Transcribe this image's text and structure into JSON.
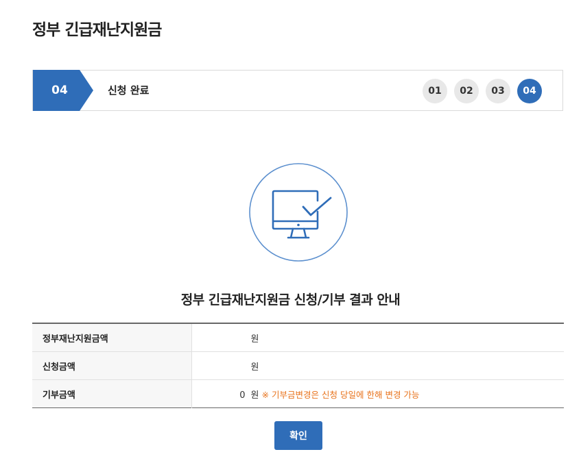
{
  "page": {
    "title": "정부 긴급재난지원금"
  },
  "steps": {
    "current_number": "04",
    "current_title": "신청 완료",
    "items": [
      {
        "label": "01",
        "active": false
      },
      {
        "label": "02",
        "active": false
      },
      {
        "label": "03",
        "active": false
      },
      {
        "label": "04",
        "active": true
      }
    ]
  },
  "result": {
    "icon": "monitor-check-icon",
    "title": "정부 긴급재난지원금 신청/기부 결과 안내",
    "rows": [
      {
        "label": "정부재난지원금액",
        "amount": "",
        "unit": "원",
        "note": ""
      },
      {
        "label": "신청금액",
        "amount": "",
        "unit": "원",
        "note": ""
      },
      {
        "label": "기부금액",
        "amount": "0",
        "unit": "원",
        "note": "※ 기부금변경은 신청 당일에 한해 변경 가능"
      }
    ]
  },
  "actions": {
    "confirm_label": "확인"
  },
  "colors": {
    "primary": "#2f6db8",
    "note": "#e8731c",
    "step_inactive": "#e8e8e8"
  }
}
